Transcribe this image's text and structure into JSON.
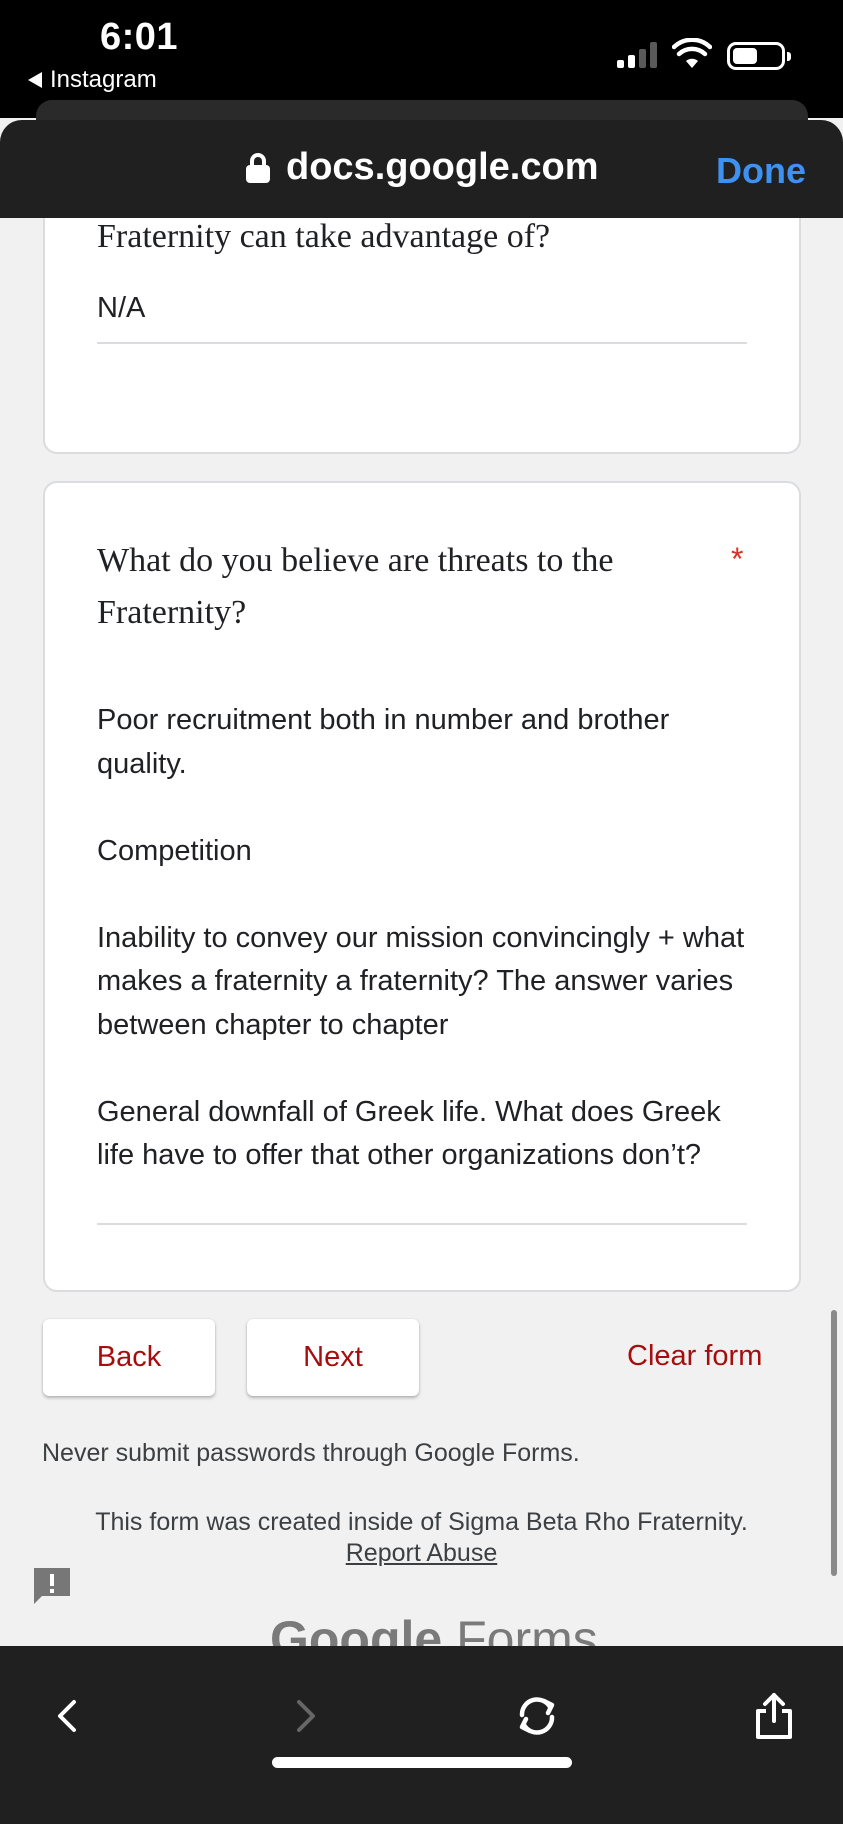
{
  "status_bar": {
    "time": "6:01",
    "back_app": "Instagram",
    "icons": [
      "signal-icon",
      "wifi-icon",
      "battery-icon"
    ]
  },
  "browser": {
    "url": "docs.google.com",
    "done_label": "Done",
    "done_color": "#3e91f1"
  },
  "form": {
    "question_prev": {
      "text": "Fraternity can take advantage of?",
      "answer": "N/A"
    },
    "question_threats": {
      "text": "What do you believe are threats to the Fraternity?",
      "required_mark": "*",
      "answer_paragraphs": [
        "Poor recruitment both in number and brother quality.",
        "Competition",
        "Inability to convey our mission convincingly + what makes a fraternity a fraternity? The answer varies between chapter to chapter",
        "General downfall of Greek life. What does Greek life have to offer that other organizations don’t?"
      ]
    },
    "buttons": {
      "back": "Back",
      "next": "Next",
      "clear": "Clear form"
    },
    "accent_color": "#a50e0e",
    "never_submit": "Never submit passwords through Google Forms.",
    "created_inside": "This form was created inside of Sigma Beta Rho Fraternity.",
    "report_abuse": "Report Abuse",
    "brand": {
      "google": "Google",
      "forms": "Forms"
    }
  },
  "toolbar": {
    "icons": [
      "back-arrow-icon",
      "forward-arrow-icon",
      "reload-icon",
      "share-icon"
    ]
  }
}
